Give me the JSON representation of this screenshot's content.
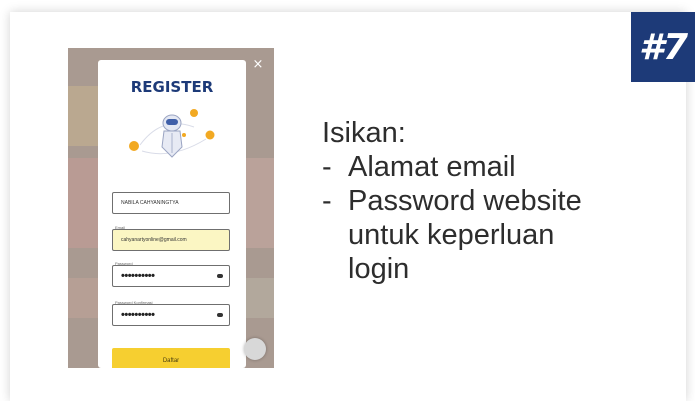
{
  "step_badge": "#7",
  "modal": {
    "close_icon": "×",
    "title": "REGISTER",
    "fields": [
      {
        "label": "",
        "value": "NABILA CAHYANINGTYA",
        "type": "text"
      },
      {
        "label": "Email",
        "value": "cahyanartyonline@gmail.com",
        "type": "text"
      },
      {
        "label": "Password",
        "value": "••••••••••",
        "type": "password"
      },
      {
        "label": "Password Konfirmasi",
        "value": "••••••••••",
        "type": "password"
      }
    ],
    "submit_label": "Daftar"
  },
  "instructions": {
    "heading": "Isikan:",
    "items": [
      "Alamat email",
      "Password website untuk keperluan login"
    ]
  },
  "colors": {
    "accent": "#1d3a78",
    "button": "#f6cf30",
    "email_field": "#fbf6c3"
  }
}
